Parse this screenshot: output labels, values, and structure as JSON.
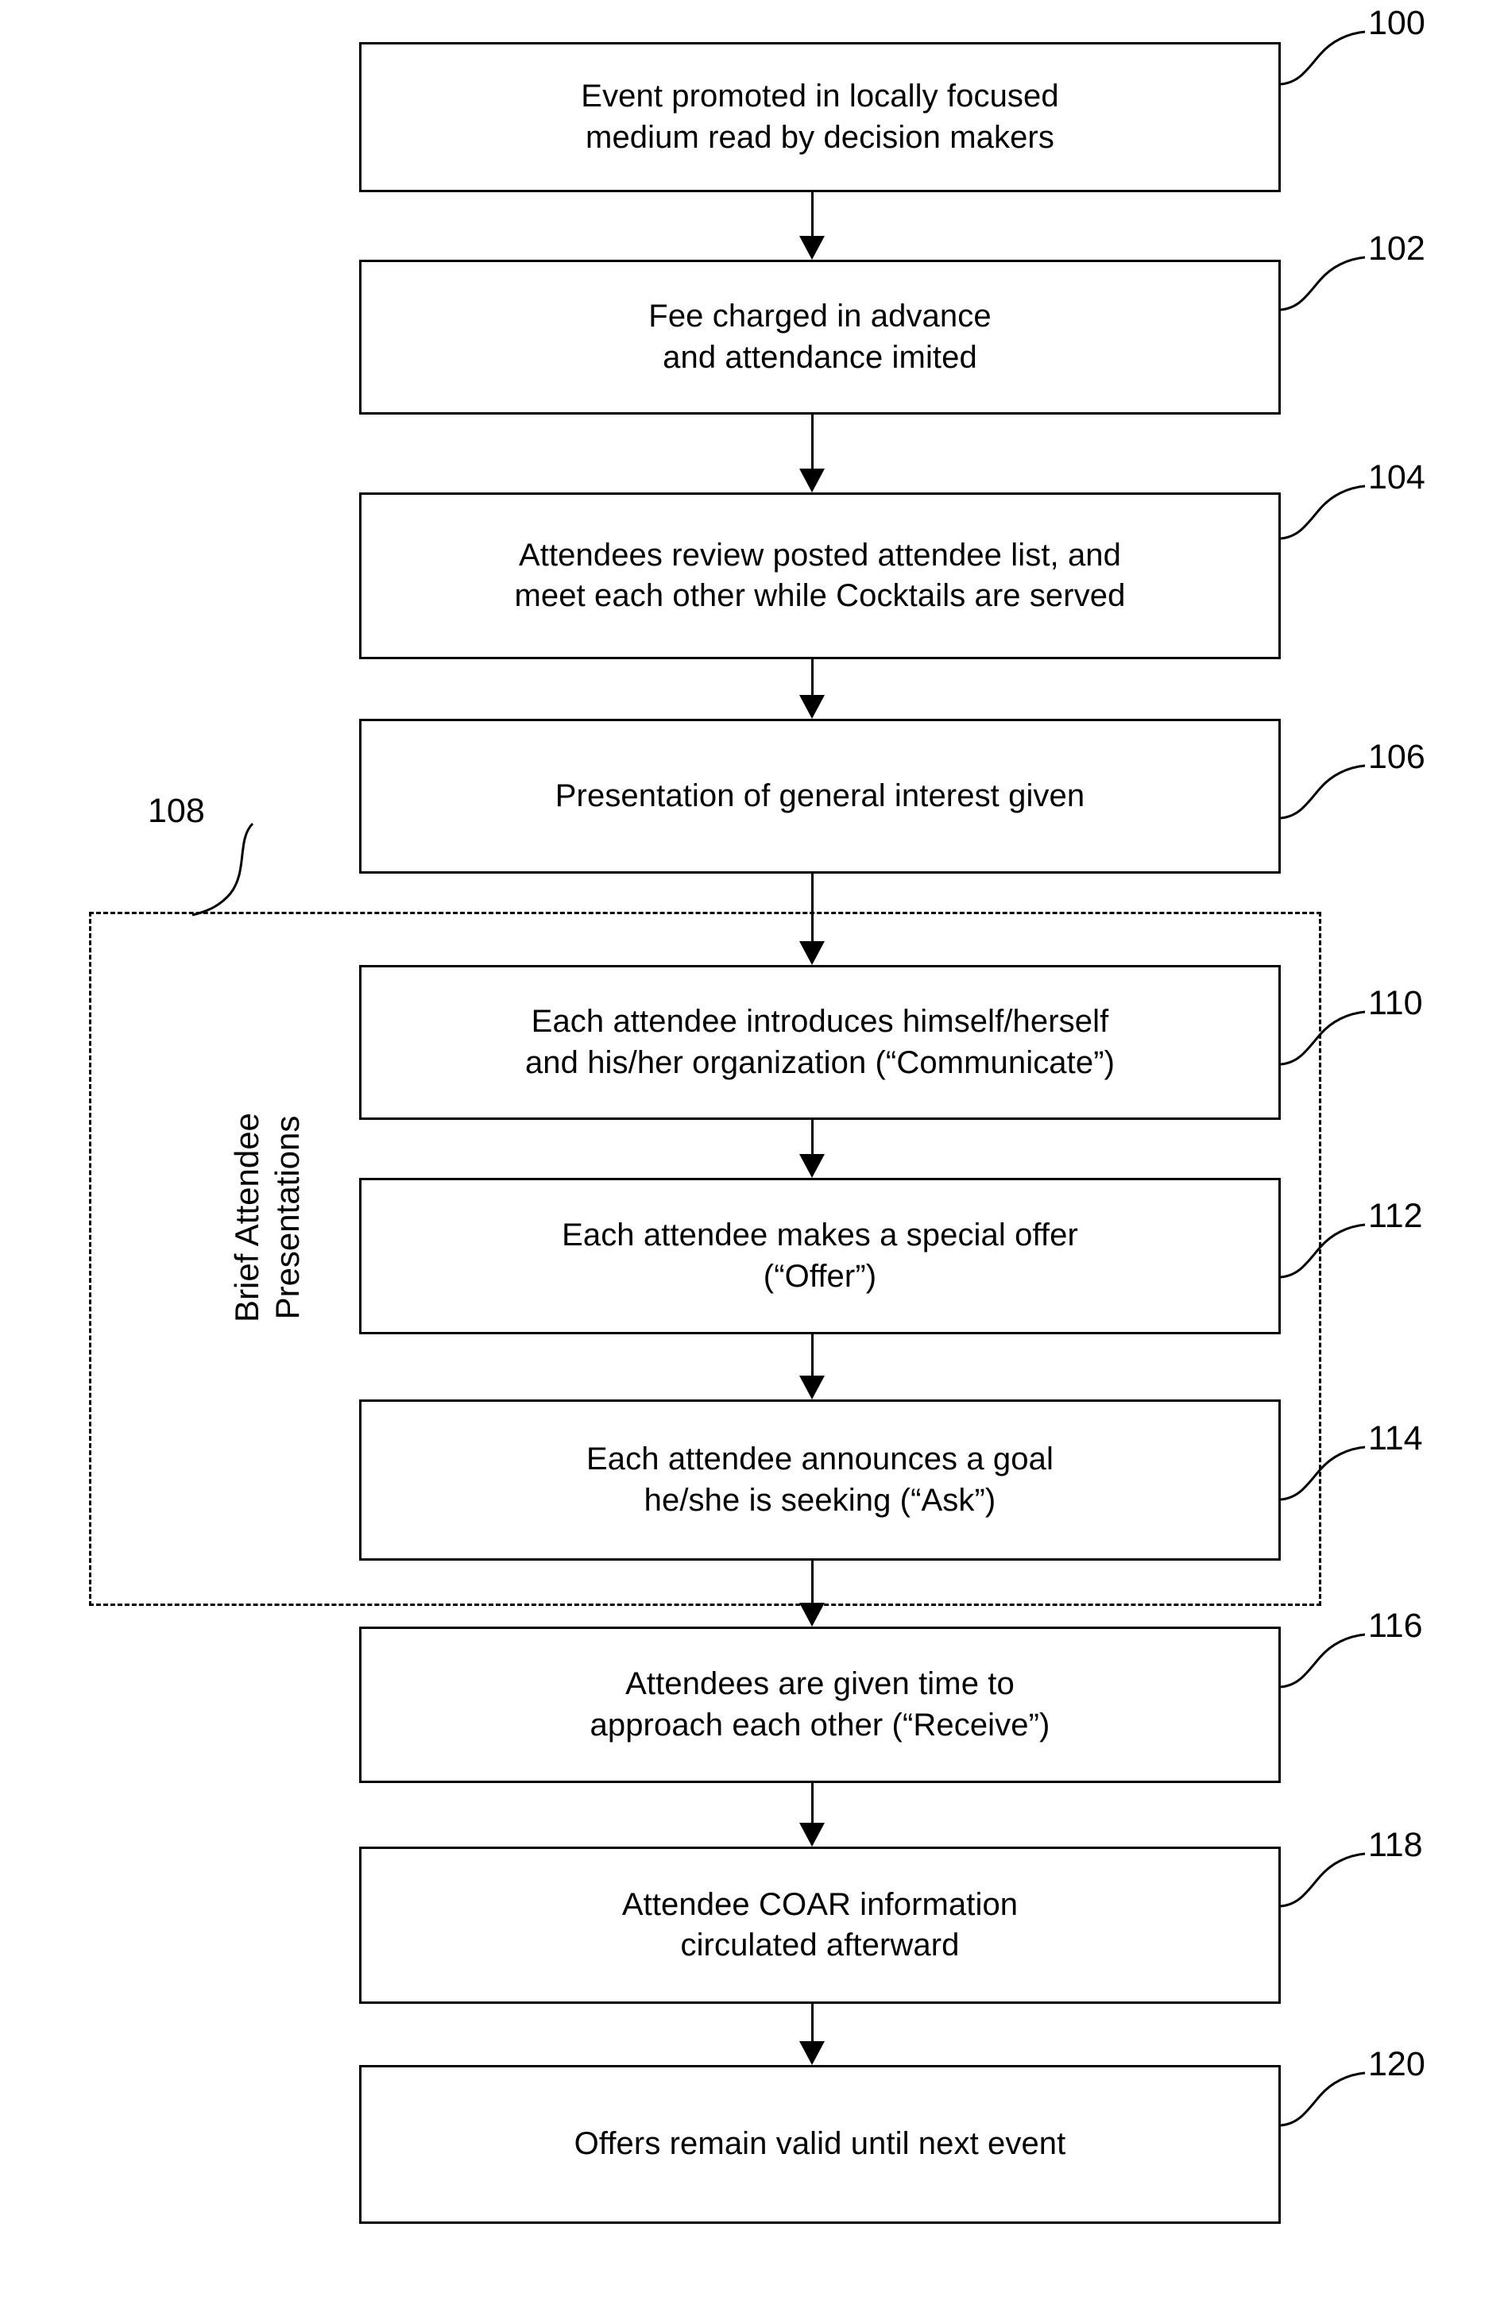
{
  "figure": {
    "type": "flowchart",
    "orientation": "vertical",
    "line_color": "#000000",
    "background_color": "#ffffff"
  },
  "group": {
    "ref": "108",
    "label": "Brief Attendee\nPresentations",
    "contains_refs": [
      "110",
      "112",
      "114"
    ]
  },
  "nodes": [
    {
      "ref": "100",
      "text": "Event promoted in locally focused\nmedium read by decision makers"
    },
    {
      "ref": "102",
      "text": "Fee charged in advance\nand attendance imited"
    },
    {
      "ref": "104",
      "text": "Attendees review posted attendee list, and\nmeet each other while Cocktails are served"
    },
    {
      "ref": "106",
      "text": "Presentation of general interest given"
    },
    {
      "ref": "110",
      "text": "Each attendee introduces himself/herself\nand his/her organization (“Communicate”)"
    },
    {
      "ref": "112",
      "text": "Each attendee makes a special offer\n(“Offer”)"
    },
    {
      "ref": "114",
      "text": "Each attendee announces a goal\nhe/she is seeking (“Ask”)"
    },
    {
      "ref": "116",
      "text": "Attendees are given time to\napproach each other (“Receive”)"
    },
    {
      "ref": "118",
      "text": "Attendee COAR information\ncirculated afterward"
    },
    {
      "ref": "120",
      "text": "Offers remain valid until next event"
    }
  ]
}
